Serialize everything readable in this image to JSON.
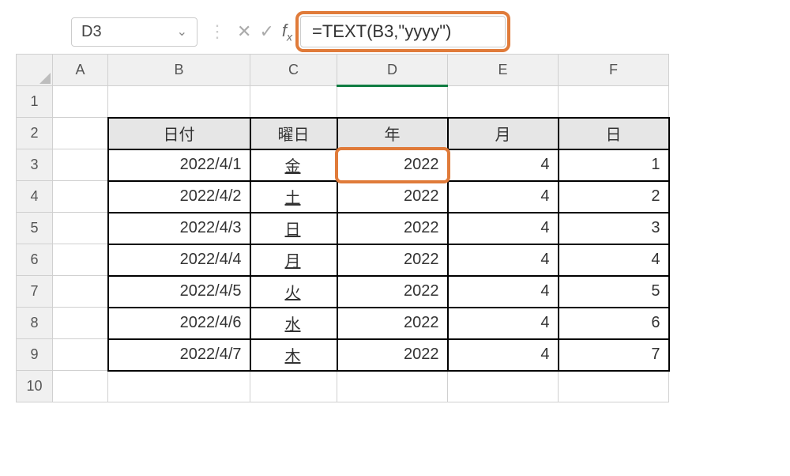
{
  "namebox": {
    "value": "D3"
  },
  "formula": {
    "value": "=TEXT(B3,\"yyyy\")"
  },
  "columns": [
    "A",
    "B",
    "C",
    "D",
    "E",
    "F"
  ],
  "rows": [
    "1",
    "2",
    "3",
    "4",
    "5",
    "6",
    "7",
    "8",
    "9",
    "10"
  ],
  "headers": {
    "date": "日付",
    "dow": "曜日",
    "year": "年",
    "month": "月",
    "day": "日"
  },
  "data": [
    {
      "date": "2022/4/1",
      "dow": "金",
      "year": "2022",
      "month": "4",
      "day": "1"
    },
    {
      "date": "2022/4/2",
      "dow": "土",
      "year": "2022",
      "month": "4",
      "day": "2"
    },
    {
      "date": "2022/4/3",
      "dow": "日",
      "year": "2022",
      "month": "4",
      "day": "3"
    },
    {
      "date": "2022/4/4",
      "dow": "月",
      "year": "2022",
      "month": "4",
      "day": "4"
    },
    {
      "date": "2022/4/5",
      "dow": "火",
      "year": "2022",
      "month": "4",
      "day": "5"
    },
    {
      "date": "2022/4/6",
      "dow": "水",
      "year": "2022",
      "month": "4",
      "day": "6"
    },
    {
      "date": "2022/4/7",
      "dow": "木",
      "year": "2022",
      "month": "4",
      "day": "7"
    }
  ],
  "active_cell": "D3",
  "selected_column": "D"
}
